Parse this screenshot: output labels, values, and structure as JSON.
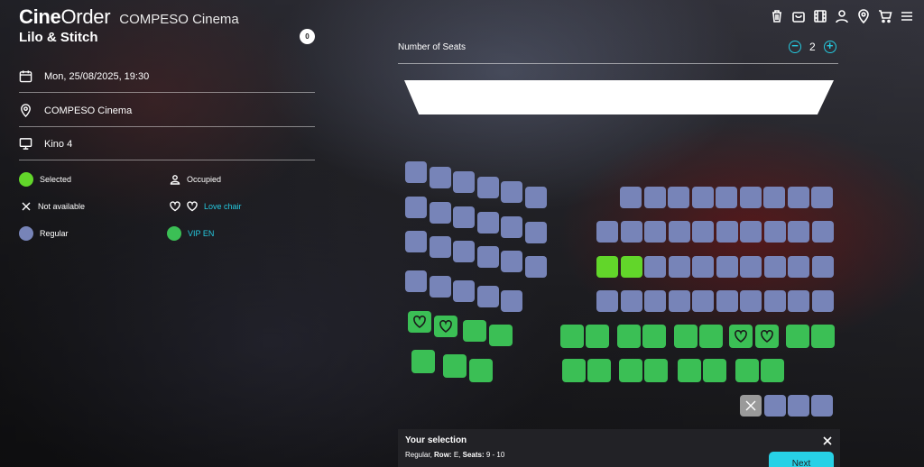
{
  "header": {
    "brand_bold": "Cine",
    "brand_regular": "Order",
    "cinema_name": "COMPESO Cinema",
    "icons": [
      "trash-icon",
      "bag-icon",
      "film-icon",
      "user-icon",
      "location-icon",
      "cart-icon",
      "menu-icon"
    ]
  },
  "movie": {
    "title": "Lilo & Stitch",
    "age_rating": "0"
  },
  "details": {
    "date": "Mon, 25/08/2025, 19:30",
    "cinema": "COMPESO Cinema",
    "hall": "Kino 4"
  },
  "legend": {
    "selected": "Selected",
    "occupied": "Occupied",
    "not_available": "Not available",
    "love_chair": "Love chair",
    "regular": "Regular",
    "vip": "VIP EN"
  },
  "seat_picker": {
    "label": "Number of Seats",
    "count": "2",
    "minus": "−",
    "plus": "+"
  },
  "colors": {
    "regular": "#7784b8",
    "vip": "#3bbf55",
    "selected": "#62d62a",
    "accent": "#25c9df",
    "unavailable": "#9a9a9a"
  },
  "selection": {
    "title": "Your selection",
    "type": "Regular",
    "row_label": "Row:",
    "row": "E",
    "seats_label": "Seats:",
    "seats": "9 - 10",
    "next": "Next"
  }
}
